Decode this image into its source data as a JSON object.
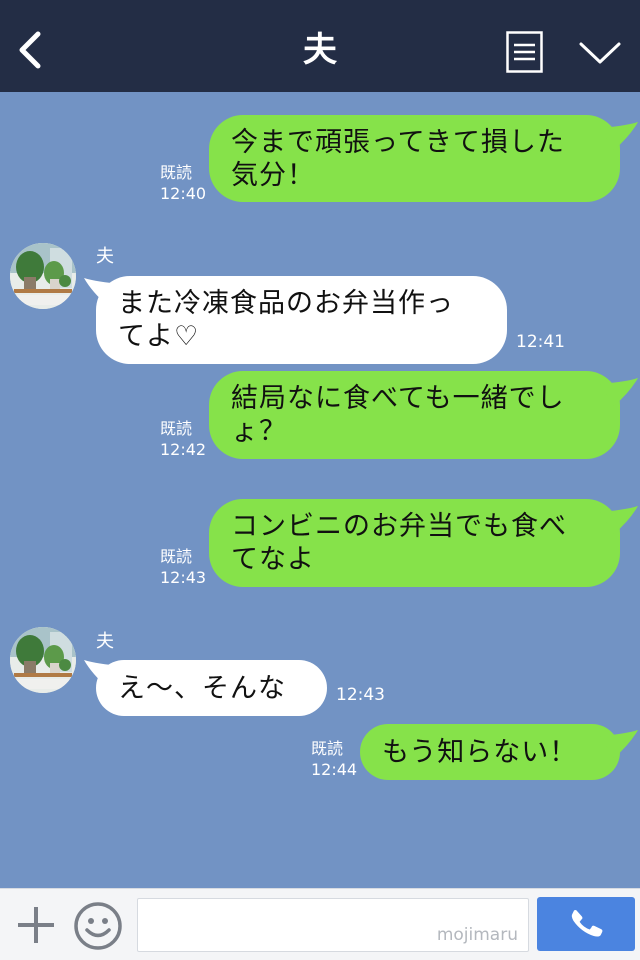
{
  "header": {
    "title": "夫"
  },
  "messages": [
    {
      "side": "me",
      "lines": [
        "今まで頑張ってきて損した",
        "気分！"
      ],
      "read": "既読",
      "time": "12:40"
    },
    {
      "side": "them",
      "sender": "夫",
      "lines": [
        "また冷凍食品のお弁当作っ",
        "てよ♡"
      ],
      "time": "12:41"
    },
    {
      "side": "me",
      "lines": [
        "結局なに食べても一緒でし",
        "ょ？"
      ],
      "read": "既読",
      "time": "12:42"
    },
    {
      "side": "me",
      "lines": [
        "コンビニのお弁当でも食べ",
        "てなよ"
      ],
      "read": "既読",
      "time": "12:43"
    },
    {
      "side": "them",
      "sender": "夫",
      "lines": [
        "え〜、そんな"
      ],
      "time": "12:43"
    },
    {
      "side": "me",
      "lines": [
        "もう知らない！"
      ],
      "read": "既読",
      "time": "12:44"
    }
  ],
  "input": {
    "watermark": "mojimaru"
  },
  "icons": {
    "back": "chevron-left-icon",
    "menu": "list-icon",
    "dropdown": "chevron-down-icon",
    "plus": "plus-icon",
    "emoji": "smiley-icon",
    "call": "phone-icon"
  },
  "colors": {
    "header_bg": "#232d45",
    "chat_bg": "#7293c4",
    "my_bubble": "#86e24a",
    "their_bubble": "#ffffff",
    "call_button": "#4b84e0"
  }
}
